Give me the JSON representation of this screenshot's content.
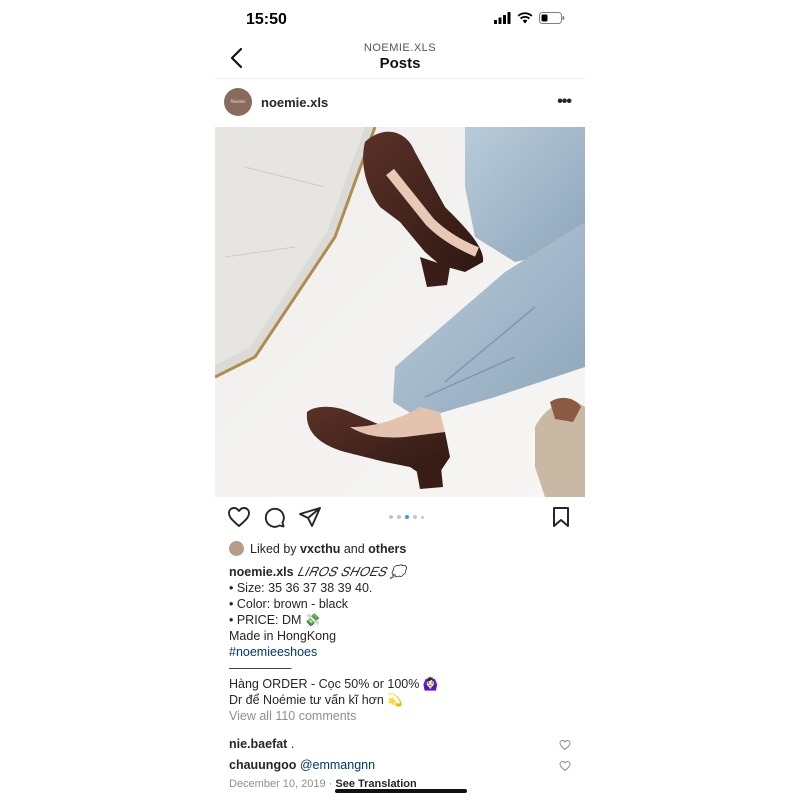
{
  "status_bar": {
    "time": "15:50"
  },
  "nav": {
    "subtitle": "NOEMIE.XLS",
    "title": "Posts"
  },
  "post": {
    "username": "noemie.xls",
    "avatar_text": "Noemie",
    "carousel": {
      "total": 5,
      "active": 3
    },
    "likes": {
      "prefix": "Liked by",
      "user": "vxcthu",
      "middle": "and",
      "suffix": "others"
    },
    "caption": {
      "username": "noemie.xls",
      "brand": "𝐿𝐼𝑅𝑂𝑆 𝑆𝐻𝑂𝐸𝑆 💭",
      "lines": [
        "• Size: 35 36 37 38 39 40.",
        "• Color: brown - black",
        "• PRICE: DM 💸",
        "Made in HongKong"
      ],
      "hashtag": "#noemieeshoes",
      "divider": "—————",
      "order_lines": [
        "Hàng ORDER - Cọc 50% or 100% 🙆🏻‍♀️",
        "Dr để Noémie tư vấn kĩ hơn 💫"
      ]
    },
    "view_comments": "View all 110 comments",
    "comments": [
      {
        "user": "nie.baefat",
        "text": "."
      },
      {
        "user": "chauungoo",
        "text": "@emmangnn"
      }
    ],
    "date": "December 10, 2019",
    "see_translation": "See Translation"
  },
  "colors": {
    "accent": "#3897f0",
    "link": "#00376b",
    "muted": "#8e8e8e",
    "text": "#262626"
  }
}
